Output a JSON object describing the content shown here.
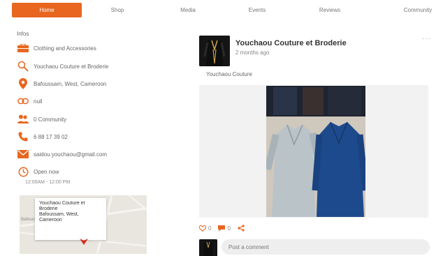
{
  "nav": {
    "tabs": [
      {
        "label": "Home"
      },
      {
        "label": "Shop"
      },
      {
        "label": "Media"
      },
      {
        "label": "Events"
      },
      {
        "label": "Reviews"
      },
      {
        "label": "Community"
      }
    ]
  },
  "about": {
    "title": "Infos",
    "category": "Clothing and Accessories",
    "name": "Youchaou Couture et Broderie",
    "location": "Bafoussam, West, Cameroon",
    "link": "null",
    "community": "0 Community",
    "phone": "6 88 17 39 02",
    "email": "saidou.youchaou@gmail.com",
    "hours_label": "Open now",
    "hours_detail": "12:00AM - 12:00 PM"
  },
  "map": {
    "card_lines": [
      "Youchaou Couture et",
      "Broderie",
      "Bafoussam, West,",
      "Cameroon"
    ],
    "left_label": "Bafoussam"
  },
  "post": {
    "author": "Youchaou Couture et Broderie",
    "time": "2 months ago",
    "caption": "Youchaou Couture",
    "likes": "0",
    "comments": "0",
    "comment_placeholder": "Post a comment"
  },
  "colors": {
    "accent": "#e8661f"
  }
}
